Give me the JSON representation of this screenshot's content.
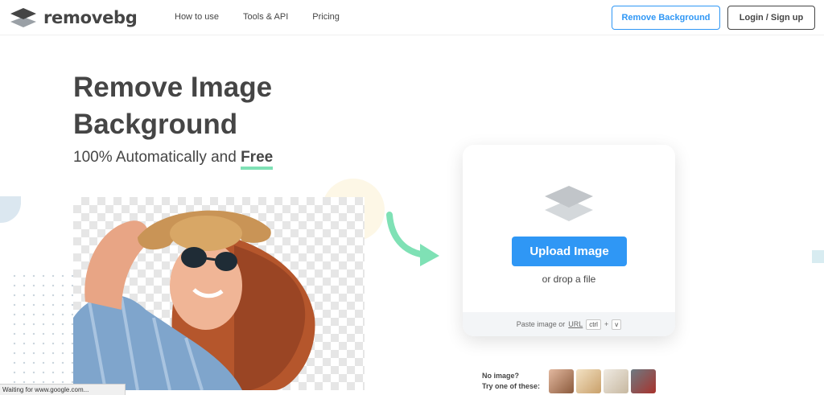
{
  "header": {
    "logo_prefix": "remove",
    "logo_suffix": "bg",
    "nav": [
      "How to use",
      "Tools & API",
      "Pricing"
    ],
    "remove_background_label": "Remove Background",
    "login_label": "Login / Sign up"
  },
  "hero": {
    "title": "Remove Image Background",
    "subtitle_prefix": "100% Automatically and ",
    "subtitle_highlight": "Free"
  },
  "upload": {
    "button_label": "Upload Image",
    "drop_text": "or drop a file",
    "paste_prefix": "Paste image or ",
    "paste_url": "URL",
    "key_ctrl": "ctrl",
    "key_plus": "+",
    "key_v": "v"
  },
  "samples": {
    "line1": "No image?",
    "line2": "Try one of these:"
  },
  "status_bar": "Waiting for www.google.com...",
  "colors": {
    "accent_blue": "#2f97f5",
    "highlight_green": "#7fe1b5",
    "text_dark": "#454545"
  }
}
